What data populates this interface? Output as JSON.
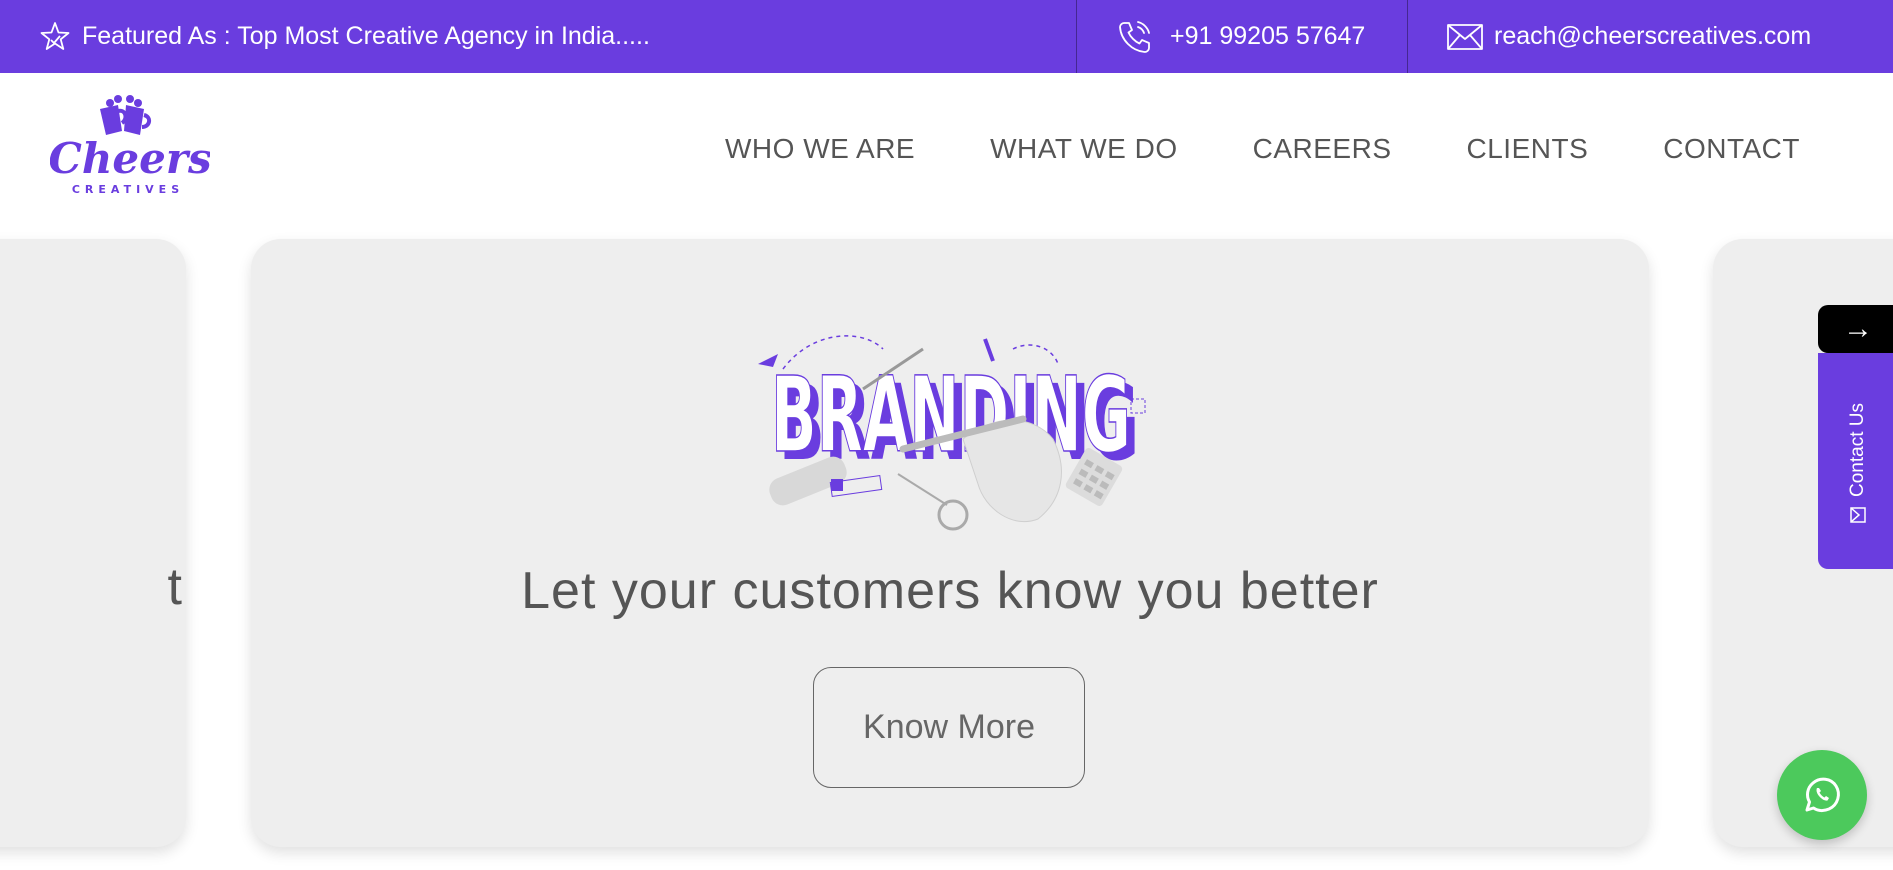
{
  "topbar": {
    "featured_text": "Featured As : Top Most Creative Agency in India.....",
    "phone": "+91 99205 57647",
    "email": "reach@cheerscreatives.com",
    "icons": [
      "star-badge-icon",
      "phone-icon",
      "mail-icon"
    ]
  },
  "header": {
    "logo_text": "Cheers",
    "logo_subtext": "CREATIVES",
    "nav": [
      {
        "label": "WHO WE ARE"
      },
      {
        "label": "WHAT WE DO"
      },
      {
        "label": "CAREERS"
      },
      {
        "label": "CLIENTS"
      },
      {
        "label": "CONTACT"
      }
    ]
  },
  "slider": {
    "illustration_word": "BRANDING",
    "tagline": "Let your customers know you better",
    "cta_label": "Know More",
    "left_peek_text": "t"
  },
  "side": {
    "arrow_label": "→",
    "contact_tab_label": "Contact Us"
  },
  "colors": {
    "brand_purple": "#6a3ddf",
    "card_bg": "#eeeeee",
    "whatsapp_green": "#4cc95c",
    "text_gray": "#555555"
  }
}
